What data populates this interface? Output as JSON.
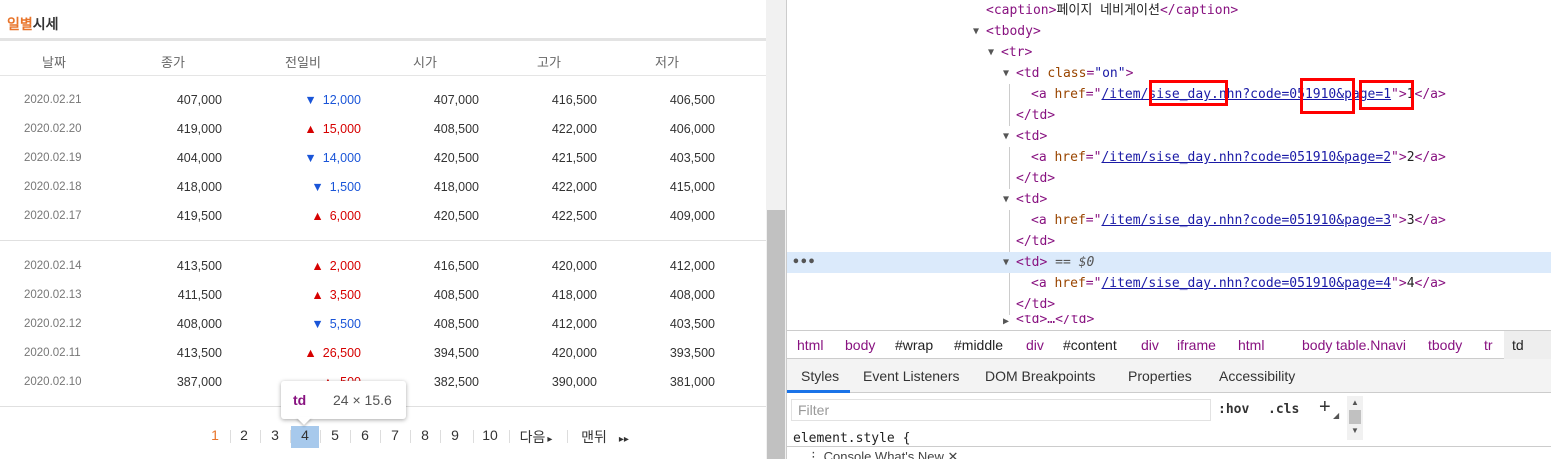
{
  "page": {
    "title_accent": "일별",
    "title_rest": "시세",
    "columns": [
      "날짜",
      "종가",
      "전일비",
      "시가",
      "고가",
      "저가"
    ],
    "rows": [
      {
        "date": "2020.02.21",
        "close": "407,000",
        "dir": "down",
        "diff": "12,000",
        "open": "407,000",
        "high": "416,500",
        "low": "406,500"
      },
      {
        "date": "2020.02.20",
        "close": "419,000",
        "dir": "up",
        "diff": "15,000",
        "open": "408,500",
        "high": "422,000",
        "low": "406,000"
      },
      {
        "date": "2020.02.19",
        "close": "404,000",
        "dir": "down",
        "diff": "14,000",
        "open": "420,500",
        "high": "421,500",
        "low": "403,500"
      },
      {
        "date": "2020.02.18",
        "close": "418,000",
        "dir": "down",
        "diff": "1,500",
        "open": "418,000",
        "high": "422,000",
        "low": "415,000"
      },
      {
        "date": "2020.02.17",
        "close": "419,500",
        "dir": "up",
        "diff": "6,000",
        "open": "420,500",
        "high": "422,500",
        "low": "409,000"
      },
      {
        "date": "2020.02.14",
        "close": "413,500",
        "dir": "up",
        "diff": "2,000",
        "open": "416,500",
        "high": "420,000",
        "low": "412,000"
      },
      {
        "date": "2020.02.13",
        "close": "411,500",
        "dir": "up",
        "diff": "3,500",
        "open": "408,500",
        "high": "418,000",
        "low": "408,000"
      },
      {
        "date": "2020.02.12",
        "close": "408,000",
        "dir": "down",
        "diff": "5,500",
        "open": "408,500",
        "high": "412,000",
        "low": "403,500"
      },
      {
        "date": "2020.02.11",
        "close": "413,500",
        "dir": "up",
        "diff": "26,500",
        "open": "394,500",
        "high": "420,000",
        "low": "393,500"
      },
      {
        "date": "2020.02.10",
        "close": "387,000",
        "dir": "up",
        "diff": "500",
        "open": "382,500",
        "high": "390,000",
        "low": "381,000"
      }
    ],
    "arrows": {
      "up": "▲",
      "down": "▼"
    },
    "pager": {
      "pages": [
        "1",
        "2",
        "3",
        "4",
        "5",
        "6",
        "7",
        "8",
        "9",
        "10"
      ],
      "current": "1",
      "next": "다음",
      "next_icon": "▸",
      "last": "맨뒤",
      "last_icon": "▸▸"
    },
    "tooltip": {
      "tag": "td",
      "size": "24 × 15.6"
    }
  },
  "devtools": {
    "dom": {
      "caption_open": "<caption>",
      "caption_text": "페이지 네비게이션",
      "caption_close": "</caption>",
      "tbody": "<tbody>",
      "tr": "<tr>",
      "td_on_open": "<td",
      "td_on_attr": "class",
      "td_on_val": "\"on\"",
      "td_open": "<td>",
      "td_close": "</td>",
      "td_selected_marker": "== $0",
      "a_open": "<a",
      "href_attr": "href",
      "links": [
        {
          "href": "/item/sise_day.nhn?code=051910&page=1",
          "text": "1"
        },
        {
          "href": "/item/sise_day.nhn?code=051910&page=2",
          "text": "2"
        },
        {
          "href": "/item/sise_day.nhn?code=051910&page=3",
          "text": "3"
        },
        {
          "href": "/item/sise_day.nhn?code=051910&page=4",
          "text": "4"
        }
      ],
      "a_close": "</a>",
      "partial": "<td>…</td>",
      "ellipsis": "•••"
    },
    "breadcrumbs": [
      "html",
      "body",
      "#wrap",
      "#middle",
      "div",
      "#content",
      "div",
      "iframe",
      "html",
      "body",
      "table.Nnavi",
      "tbody",
      "tr",
      "td"
    ],
    "tabs": [
      "Styles",
      "Event Listeners",
      "DOM Breakpoints",
      "Properties",
      "Accessibility"
    ],
    "filter_placeholder": "Filter",
    "hov": ":hov",
    "cls": ".cls",
    "plus": "+",
    "element_style": "element.style {",
    "bottom_tabs": "⋮   Console   What's New ✕"
  }
}
